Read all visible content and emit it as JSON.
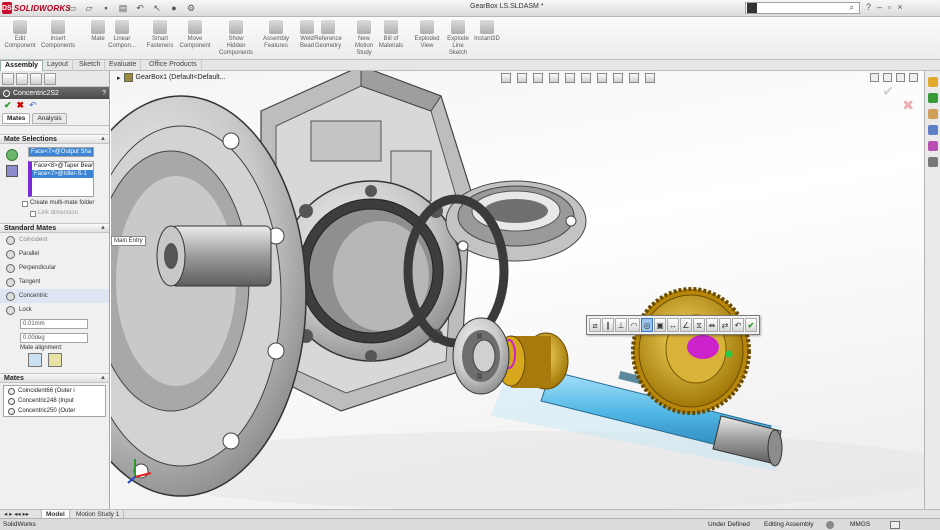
{
  "app": {
    "logo_text": "SOLIDWORKS",
    "logo_mark": "DS",
    "document_title": "GearBox LS.SLDASM *"
  },
  "search": {
    "placeholder": "",
    "value": ""
  },
  "toolbar": {
    "buttons": [
      {
        "label": "Edit\nComponent",
        "icon": "edit-component-icon"
      },
      {
        "label": "Insert\nComponents",
        "icon": "insert-components-icon"
      },
      {
        "label": "Mate",
        "icon": "mate-icon"
      },
      {
        "label": "Linear\nCompon...",
        "icon": "linear-pattern-icon"
      },
      {
        "label": "Smart\nFasteners",
        "icon": "smart-fasteners-icon"
      },
      {
        "label": "Move\nComponent",
        "icon": "move-component-icon"
      },
      {
        "label": "Show\nHidden\nComponents",
        "icon": "show-hidden-icon"
      },
      {
        "label": "Assembly\nFeatures",
        "icon": "assembly-features-icon"
      },
      {
        "label": "Weld\nBead",
        "icon": "weld-bead-icon"
      },
      {
        "label": "Reference\nGeometry",
        "icon": "reference-geometry-icon"
      },
      {
        "label": "New\nMotion\nStudy",
        "icon": "motion-study-icon"
      },
      {
        "label": "Bill of\nMaterials",
        "icon": "bom-icon"
      },
      {
        "label": "Exploded\nView",
        "icon": "exploded-view-icon"
      },
      {
        "label": "Explode\nLine\nSketch",
        "icon": "explode-line-icon"
      },
      {
        "label": "Instant3D",
        "icon": "instant3d-icon"
      }
    ],
    "tabs": [
      "Assembly",
      "Layout",
      "Sketch",
      "Evaluate",
      "Office Products"
    ],
    "active_tab": "Assembly"
  },
  "property_manager": {
    "title": "Concentric2S2",
    "sub_tabs": [
      "Mates",
      "Analysis"
    ],
    "active_sub_tab": "Mates",
    "mate_selections": {
      "header": "Mate Selections",
      "entity": "Face<7>@Output Sha",
      "list": [
        "Face<8>@Taper Bear",
        "Face<7>@Idler-S-1"
      ],
      "multimate_label": "Create multi-mate folder",
      "link_label": "Link dimension"
    },
    "standard_mates": {
      "header": "Standard Mates",
      "items": [
        "Coincident",
        "Parallel",
        "Perpendicular",
        "Tangent",
        "Concentric",
        "Lock"
      ],
      "selected": "Concentric",
      "distance_value": "0.01mm",
      "angle_value": "0.00deg",
      "alignment_label": "Mate alignment:"
    },
    "mates_list": {
      "header": "Mates",
      "items": [
        "Coincident66 (Outer i",
        "Concentric248 (Input",
        "Concentric250 (Outer"
      ]
    }
  },
  "viewport": {
    "flyout_tree": "GearBox1 (Default<Default...",
    "callout": "Main Entry",
    "popup_toolbar": [
      "coincident",
      "parallel",
      "perpendicular",
      "tangent",
      "concentric",
      "lock",
      "distance",
      "angle",
      "symmetric",
      "width",
      "flip",
      "undo",
      "ok"
    ]
  },
  "bottom_tabs": [
    "Model",
    "Motion Study 1"
  ],
  "active_bottom_tab": "Model",
  "status": {
    "app_name": "SolidWorks",
    "definition": "Under Defined",
    "mode": "Editing Assembly",
    "units": "MMGS"
  },
  "colors": {
    "brand_red": "#c8102e",
    "gear_gold": "#d4a514",
    "shaft_blue": "#4fb6e4",
    "selection_blue": "#3c85d6",
    "mate_magenta": "#cc22cc"
  }
}
